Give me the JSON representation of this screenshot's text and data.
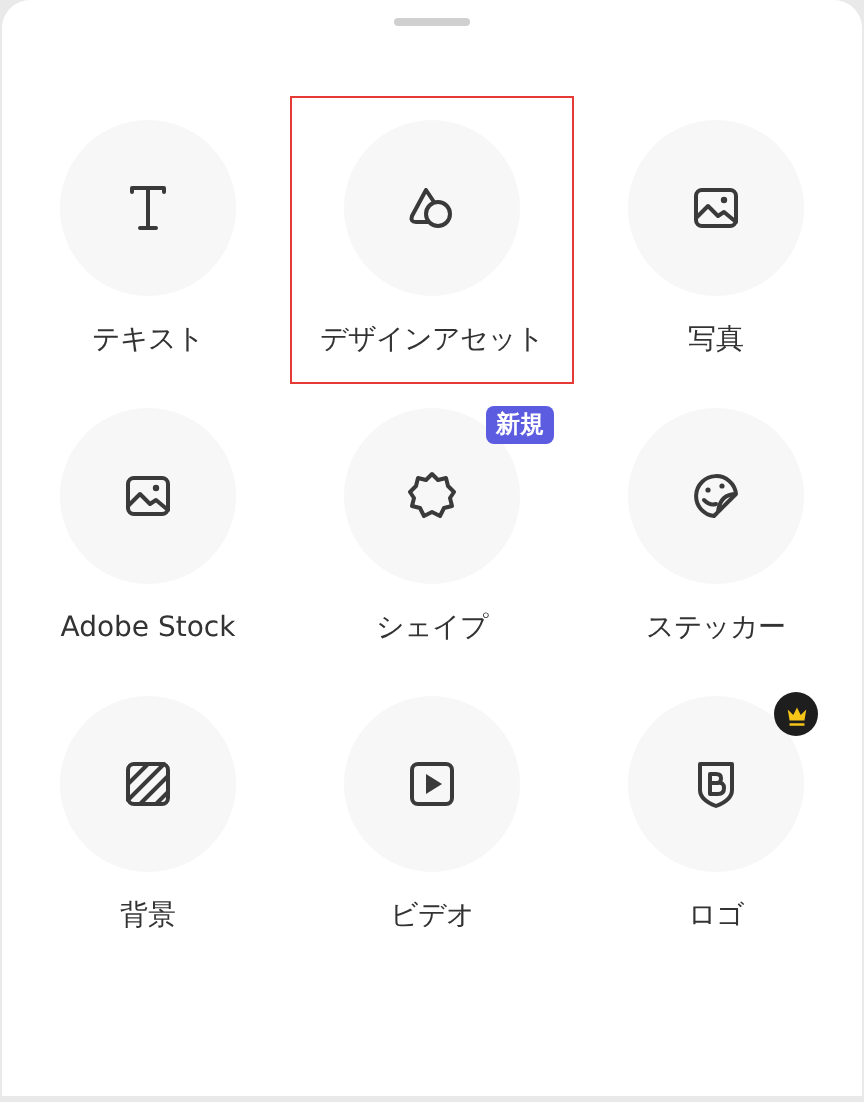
{
  "items": [
    {
      "label": "テキスト",
      "kind": "text",
      "selected": false
    },
    {
      "label": "デザインアセット",
      "kind": "shapes",
      "selected": true
    },
    {
      "label": "写真",
      "kind": "image",
      "selected": false
    },
    {
      "label": "Adobe Stock",
      "kind": "image",
      "selected": false
    },
    {
      "label": "シェイプ",
      "kind": "badge-shape",
      "selected": false,
      "badge": {
        "kind": "new",
        "text": "新規"
      }
    },
    {
      "label": "ステッカー",
      "kind": "sticker",
      "selected": false
    },
    {
      "label": "背景",
      "kind": "stripes",
      "selected": false
    },
    {
      "label": "ビデオ",
      "kind": "video",
      "selected": false
    },
    {
      "label": "ロゴ",
      "kind": "shield",
      "selected": false,
      "badge": {
        "kind": "premium"
      }
    }
  ]
}
